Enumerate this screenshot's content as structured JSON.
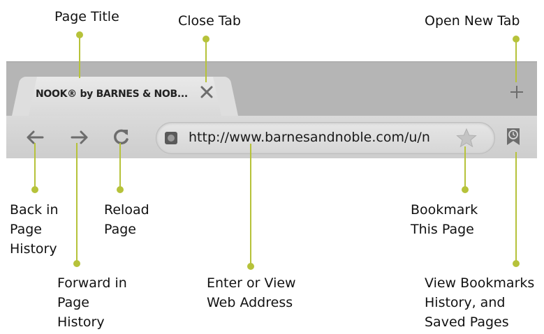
{
  "browser": {
    "tab_title": "NOOK® by BARNES & NOB...",
    "url": "http://www.barnesandnoble.com/u/n"
  },
  "callouts": {
    "page_title": "Page Title",
    "close_tab": "Close Tab",
    "open_new_tab": "Open New Tab",
    "back": [
      "Back in",
      "Page",
      "History"
    ],
    "forward": [
      "Forward in",
      "Page",
      "History"
    ],
    "reload": [
      "Reload",
      "Page"
    ],
    "address": [
      "Enter or View",
      "Web Address"
    ],
    "bookmark": [
      "Bookmark",
      "This Page"
    ],
    "view_bookmarks": [
      "View Bookmarks",
      "History, and",
      "Saved Pages"
    ]
  },
  "colors": {
    "callout_line": "#b6c23a",
    "browser_frame": "#b5b5b5",
    "icon_gray": "#6d6d6d"
  },
  "icons": [
    "back-arrow-icon",
    "forward-arrow-icon",
    "reload-icon",
    "close-icon",
    "plus-icon",
    "star-icon",
    "bookmarks-clock-icon",
    "favicon-icon"
  ]
}
